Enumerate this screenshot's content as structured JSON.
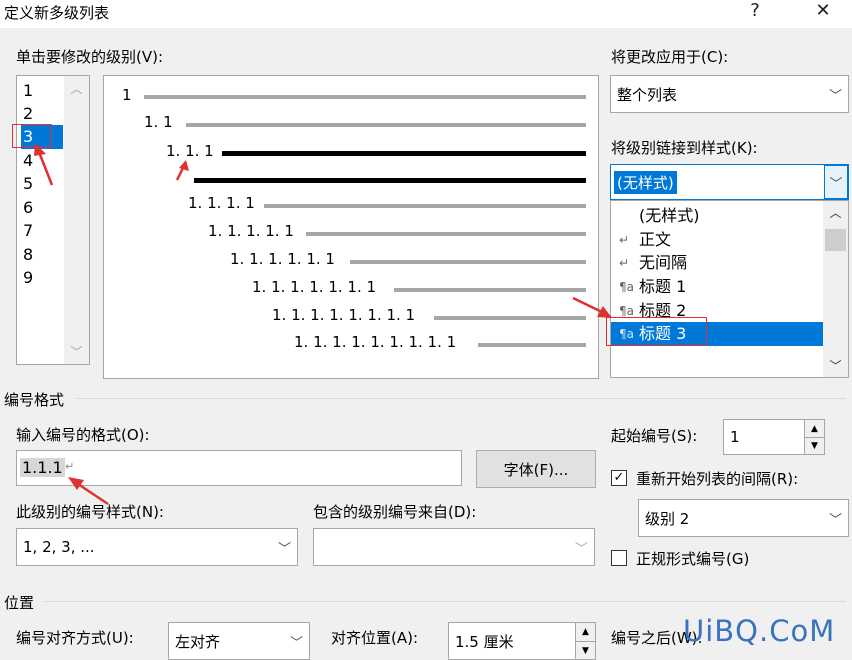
{
  "window": {
    "title": "定义新多级列表",
    "help_glyph": "?",
    "close_glyph": "✕"
  },
  "level_section": {
    "label": "单击要修改的级别(V):",
    "levels": [
      "1",
      "2",
      "3",
      "4",
      "5",
      "6",
      "7",
      "8",
      "9"
    ],
    "selected_level": "3"
  },
  "preview": {
    "rows": [
      "1",
      "1. 1",
      "1. 1. 1",
      "",
      "1. 1. 1. 1",
      "1. 1. 1. 1. 1",
      "1. 1. 1. 1. 1. 1",
      "1. 1. 1. 1. 1. 1. 1",
      "1. 1. 1. 1. 1. 1. 1. 1",
      "1. 1. 1. 1. 1. 1. 1. 1. 1"
    ]
  },
  "apply_to": {
    "label": "将更改应用于(C):",
    "value": "整个列表"
  },
  "link_style": {
    "label": "将级别链接到样式(K):",
    "value": "(无样式)",
    "options": [
      {
        "icon": "",
        "text": "(无样式)"
      },
      {
        "icon": "↵",
        "text": "正文"
      },
      {
        "icon": "↵",
        "text": "无间隔"
      },
      {
        "icon": "¶a",
        "text": "标题 1"
      },
      {
        "icon": "¶a",
        "text": "标题 2"
      },
      {
        "icon": "¶a",
        "text": "标题 3"
      }
    ],
    "selected": "标题 3"
  },
  "number_format": {
    "section": "编号格式",
    "format_label": "输入编号的格式(O):",
    "format_value": "1.1.1",
    "font_button": "字体(F)...",
    "style_label": "此级别的编号样式(N):",
    "style_value": "1, 2, 3, ...",
    "include_label": "包含的级别编号来自(D):",
    "include_value": ""
  },
  "start_at": {
    "label": "起始编号(S):",
    "value": "1"
  },
  "restart": {
    "label": "重新开始列表的间隔(R):",
    "checked": true,
    "value": "级别 2"
  },
  "legal": {
    "label": "正规形式编号(G)",
    "checked": false
  },
  "position": {
    "section": "位置",
    "align_label": "编号对齐方式(U):",
    "align_value": "左对齐",
    "at_label": "对齐位置(A):",
    "at_value": "1.5 厘米",
    "after_label": "编号之后(W):"
  },
  "watermark": "UiBQ.CoM",
  "colors": {
    "accent": "#0078d7",
    "annotation": "#e03030",
    "watermark": "#3a72c0"
  }
}
